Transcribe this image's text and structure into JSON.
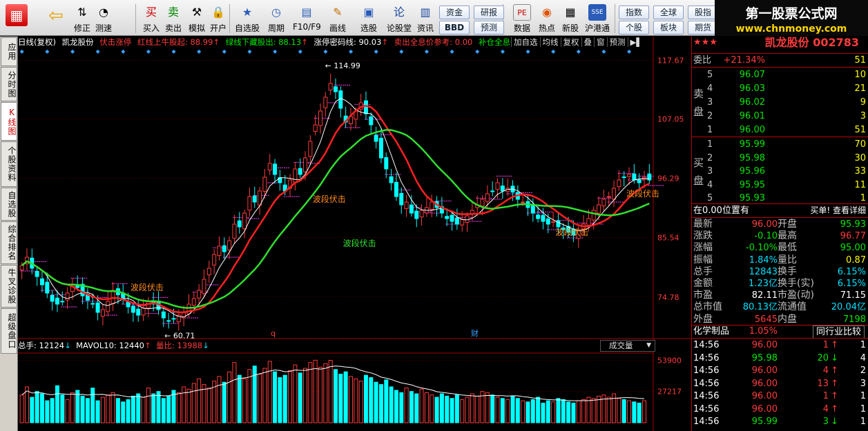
{
  "toolbar": {
    "big": [
      {
        "label": "",
        "icon": "windows-icon"
      },
      {
        "label": "",
        "icon": "back-arrow-icon"
      },
      {
        "label": "修正",
        "icon": "arrows-icon"
      },
      {
        "label": "测速",
        "icon": "speed-icon"
      },
      {
        "label": "买入",
        "icon": "buy-icon"
      },
      {
        "label": "卖出",
        "icon": "sell-icon"
      },
      {
        "label": "模拟",
        "icon": "hammer-icon"
      },
      {
        "label": "开户",
        "icon": "lock-icon"
      },
      {
        "label": "自选股",
        "icon": "star-icon"
      },
      {
        "label": "周期",
        "icon": "clock-icon"
      },
      {
        "label": "F10/F9",
        "icon": "f10-icon"
      },
      {
        "label": "画线",
        "icon": "pen-icon"
      },
      {
        "label": "选股",
        "icon": "monitor-icon"
      },
      {
        "label": "论股堂",
        "icon": "lun-icon"
      },
      {
        "label": "资讯",
        "icon": "news-icon"
      },
      {
        "label": "数据",
        "icon": "pe-icon"
      },
      {
        "label": "热点",
        "icon": "hot-icon"
      },
      {
        "label": "新股",
        "icon": "newstock-icon"
      },
      {
        "label": "沪港通",
        "icon": "hkex-icon"
      }
    ],
    "small": [
      {
        "label": "资金"
      },
      {
        "label": "BBD"
      },
      {
        "label": "研报"
      },
      {
        "label": "预测"
      },
      {
        "label": "指数"
      },
      {
        "label": "个股"
      },
      {
        "label": "全球"
      },
      {
        "label": "板块"
      },
      {
        "label": "股指"
      },
      {
        "label": "期货"
      }
    ],
    "big_glyphs": [
      "▦",
      "⇦",
      "⇅",
      "◔",
      "买",
      "卖",
      "⚒",
      "🔒",
      "★",
      "◷",
      "▤",
      "✎",
      "▣",
      "论",
      "▥",
      "PE",
      "◉",
      "▦",
      "SSE"
    ]
  },
  "banner": {
    "title": "第一股票公式网",
    "url": "www.chnmoney.com"
  },
  "left_tabs": [
    "应用",
    "分时图",
    "K线图",
    "个股资料",
    "自选股",
    "综合排名",
    "牛叉诊股",
    "超级盘口"
  ],
  "info": {
    "period": "日线(复权)",
    "name": "凯龙股份",
    "f1": "伏击涨停",
    "f2": "红线上牛股起: 88.99",
    "f2a": "↑",
    "f3": "绿线下藏股出: 88.13",
    "f3a": "↑",
    "f4": "涨停密码线: 90.03",
    "f4a": "↑",
    "f5": "卖出全息价参考: 0.00",
    "f6": "补仓全息价"
  },
  "chart_tabs": [
    "加自选",
    "均线",
    "复权",
    "叠",
    "窗",
    "预测"
  ],
  "chart_data": {
    "type": "candlestick",
    "y_ticks": [
      117.67,
      107.05,
      96.29,
      85.54,
      74.78
    ],
    "ylim": [
      68.0,
      119.5
    ],
    "markers": {
      "high_label": "114.99",
      "low_label": "60.71",
      "q": "q",
      "cai": "财"
    },
    "annotations": [
      "波段伏击",
      "波段伏击",
      "波段伏击",
      "波段伏击",
      "波段伏击"
    ],
    "closes": [
      80.5,
      82.0,
      80.0,
      78.5,
      77.0,
      75.5,
      74.0,
      73.5,
      74.0,
      75.5,
      77.0,
      76.5,
      75.0,
      74.2,
      73.5,
      72.0,
      72.5,
      74.0,
      76.0,
      75.2,
      74.5,
      73.0,
      72.0,
      71.5,
      72.8,
      74.0,
      73.5,
      72.5,
      71.0,
      70.5,
      70.8,
      71.5,
      72.0,
      73.5,
      74.5,
      76.0,
      78.0,
      80.0,
      82.5,
      84.0,
      83.0,
      85.0,
      88.0,
      87.5,
      90.0,
      93.0,
      92.0,
      94.0,
      96.5,
      99.0,
      97.0,
      95.5,
      94.0,
      96.0,
      98.0,
      97.0,
      100.0,
      103.0,
      106.0,
      108.5,
      111.0,
      113.5,
      112.0,
      109.0,
      106.5,
      107.5,
      108.5,
      110.0,
      108.0,
      106.0,
      103.0,
      100.0,
      98.0,
      95.5,
      93.0,
      91.5,
      92.0,
      90.0,
      89.0,
      90.5,
      91.0,
      92.0,
      91.0,
      90.0,
      89.0,
      88.5,
      88.0,
      88.8,
      89.5,
      90.5,
      91.5,
      92.5,
      93.5,
      94.0,
      95.5,
      94.0,
      94.5,
      93.8,
      92.5,
      92.0,
      91.0,
      90.0,
      89.0,
      88.5,
      88.0,
      88.5,
      87.5,
      87.0,
      86.5,
      86.0,
      87.0,
      88.0,
      89.0,
      90.5,
      91.5,
      92.5,
      93.0,
      94.5,
      96.0,
      96.5,
      97.0,
      96.0,
      95.5,
      96.5,
      96.0
    ],
    "vol_ticks": [
      53900,
      27217
    ],
    "vol_max": 56000,
    "volumes": [
      24000,
      31000,
      22000,
      27000,
      25000,
      19000,
      21000,
      32000,
      24000,
      20000,
      26000,
      28000,
      23000,
      21000,
      30000,
      19000,
      22000,
      24000,
      26000,
      21000,
      18000,
      20000,
      23000,
      25000,
      22000,
      30000,
      25000,
      27000,
      21000,
      23000,
      28000,
      26000,
      31000,
      29000,
      34000,
      38000,
      33000,
      30000,
      36000,
      40000,
      35000,
      44000,
      52000,
      41000,
      38000,
      46000,
      49000,
      42000,
      47000,
      53000,
      44000,
      39000,
      41000,
      45000,
      50000,
      43000,
      47000,
      52000,
      54000,
      48000,
      51000,
      53900,
      46000,
      42000,
      44000,
      40000,
      38000,
      36000,
      41000,
      39000,
      35000,
      33000,
      37000,
      31000,
      28000,
      26000,
      30000,
      27000,
      25000,
      29000,
      26000,
      24000,
      22000,
      25000,
      23000,
      21000,
      24000,
      20000,
      22000,
      25000,
      23000,
      27000,
      26000,
      24000,
      22000,
      21000,
      20000,
      23000,
      21000,
      19000,
      18000,
      20000,
      22000,
      17000,
      19000,
      18000,
      21000,
      20000,
      18000,
      17000,
      19000,
      20000,
      22000,
      21000,
      23000,
      24000,
      22000,
      25000,
      21000,
      20000,
      19000,
      18000,
      17000,
      19000
    ]
  },
  "vol_info": {
    "total": "总手: 12124",
    "total_a": "↓",
    "mavol": "MAVOL10: 12440",
    "mavol_a": "↑",
    "ratio": "量比: 13988",
    "ratio_a": "↓",
    "select": "成交量"
  },
  "quote": {
    "title": "凯龙股份 002783",
    "weibi_label": "委比",
    "weibi": "+21.34%",
    "weibi_v": "51",
    "sell_label": "卖盘",
    "buy_label": "买盘",
    "sells": [
      {
        "n": "5",
        "p": "96.07",
        "v": "10"
      },
      {
        "n": "4",
        "p": "96.03",
        "v": "21"
      },
      {
        "n": "3",
        "p": "96.02",
        "v": "9"
      },
      {
        "n": "2",
        "p": "96.01",
        "v": "3"
      },
      {
        "n": "1",
        "p": "96.00",
        "v": "51"
      }
    ],
    "buys": [
      {
        "n": "1",
        "p": "95.99",
        "v": "70"
      },
      {
        "n": "2",
        "p": "95.98",
        "v": "30"
      },
      {
        "n": "3",
        "p": "95.96",
        "v": "33"
      },
      {
        "n": "4",
        "p": "95.95",
        "v": "11"
      },
      {
        "n": "5",
        "p": "95.93",
        "v": "1"
      }
    ],
    "pos": "在0.00位置有",
    "pos_r": "买单! 查看详细",
    "stats": [
      {
        "l1": "最新",
        "v1": "96.00",
        "c1": "red",
        "l2": "开盘",
        "v2": "95.93",
        "c2": "grn"
      },
      {
        "l1": "涨跌",
        "v1": "-0.10",
        "c1": "grn",
        "l2": "最高",
        "v2": "96.77",
        "c2": "red"
      },
      {
        "l1": "涨幅",
        "v1": "-0.10%",
        "c1": "grn",
        "l2": "最低",
        "v2": "95.00",
        "c2": "grn"
      },
      {
        "l1": "振幅",
        "v1": "1.84%",
        "c1": "cy",
        "l2": "量比",
        "v2": "0.87",
        "c2": "yel"
      },
      {
        "l1": "总手",
        "v1": "12843",
        "c1": "cy",
        "l2": "换手",
        "v2": "6.15%",
        "c2": "cy"
      },
      {
        "l1": "金额",
        "v1": "1.23亿",
        "c1": "cy",
        "l2": "换手(实)",
        "v2": "6.15%",
        "c2": "cy"
      },
      {
        "l1": "市盈",
        "v1": "82.11",
        "c1": "wht",
        "l2": "市盈(动)",
        "v2": "71.15",
        "c2": "wht"
      },
      {
        "l1": "总市值",
        "v1": "80.13亿",
        "c1": "cy",
        "l2": "流通值",
        "v2": "20.04亿",
        "c2": "cy"
      },
      {
        "l1": "外盘",
        "v1": "5645",
        "c1": "red",
        "l2": "内盘",
        "v2": "7198",
        "c2": "grn"
      }
    ],
    "industry": "化学制品",
    "industry_pct": "1.05%",
    "industry_btn": "同行业比较",
    "ticks": [
      {
        "t": "14:56",
        "p": "96.00",
        "pc": "red",
        "v": "1",
        "a": "↑",
        "ac": "red",
        "n": "1"
      },
      {
        "t": "14:56",
        "p": "95.98",
        "pc": "grn",
        "v": "20",
        "a": "↓",
        "ac": "grn",
        "n": "4"
      },
      {
        "t": "14:56",
        "p": "96.00",
        "pc": "red",
        "v": "4",
        "a": "↑",
        "ac": "red",
        "n": "2"
      },
      {
        "t": "14:56",
        "p": "96.00",
        "pc": "red",
        "v": "13",
        "a": "↑",
        "ac": "red",
        "n": "3"
      },
      {
        "t": "14:56",
        "p": "96.00",
        "pc": "red",
        "v": "1",
        "a": "↑",
        "ac": "red",
        "n": "1"
      },
      {
        "t": "14:56",
        "p": "96.00",
        "pc": "red",
        "v": "4",
        "a": "↑",
        "ac": "red",
        "n": "1"
      },
      {
        "t": "14:56",
        "p": "95.99",
        "pc": "grn",
        "v": "3",
        "a": "↓",
        "ac": "grn",
        "n": "1"
      }
    ]
  },
  "colors": {
    "up": "#ff3b3b",
    "down": "#00ffff",
    "ma_white": "#ffffff",
    "ma_red": "#ff2020",
    "ma_green": "#30e030",
    "magenta": "#ff40ff",
    "grid": "#a00000"
  }
}
